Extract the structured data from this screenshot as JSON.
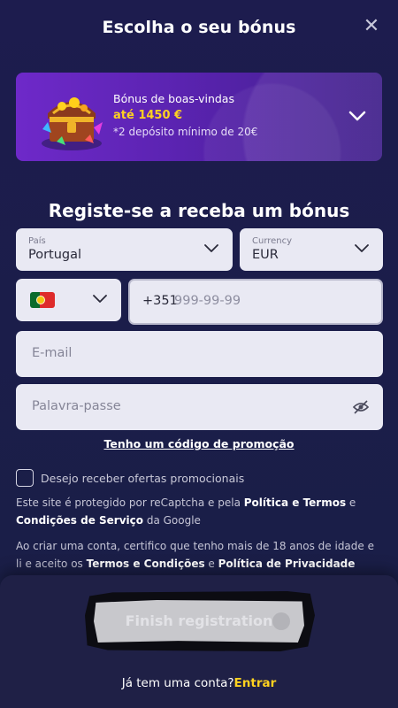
{
  "header": {
    "title": "Escolha o seu bónus",
    "close_icon": "close-icon"
  },
  "bonus": {
    "label": "Bónus de boas-vindas",
    "amount": "até 1450 €",
    "note": "*2 depósito mínimo de 20€",
    "icon": "treasure-chest-icon",
    "accent_color": "#ffd21f"
  },
  "form": {
    "title": "Registe-se a receba um bónus",
    "country": {
      "label": "País",
      "value": "Portugal"
    },
    "currency": {
      "label": "Currency",
      "value": "EUR"
    },
    "phone": {
      "prefix": "+351",
      "placeholder": "999-99-99",
      "flag": "portugal-flag-icon"
    },
    "email": {
      "placeholder": "E-mail"
    },
    "password": {
      "placeholder": "Palavra-passe"
    },
    "promo_link": "Tenho um código de promoção",
    "promo_checkbox_label": "Desejo receber ofertas promocionais",
    "legal1": {
      "part1": "Este site é protegido por reCaptcha e pela ",
      "policy_terms": "Política e Termos",
      "part2": " e ",
      "service_terms": "Condições de Serviço",
      "part3": " da Google"
    },
    "legal2": {
      "part1": "Ao criar uma conta, certifico que tenho mais de 18 anos de idade e li e aceito os ",
      "terms": "Termos e Condições",
      "part2": " e ",
      "privacy": "Política de Privacidade"
    }
  },
  "footer": {
    "finish_button": "Finish registration",
    "login_prompt": "Já tem uma conta?",
    "login_link": "Entrar"
  }
}
